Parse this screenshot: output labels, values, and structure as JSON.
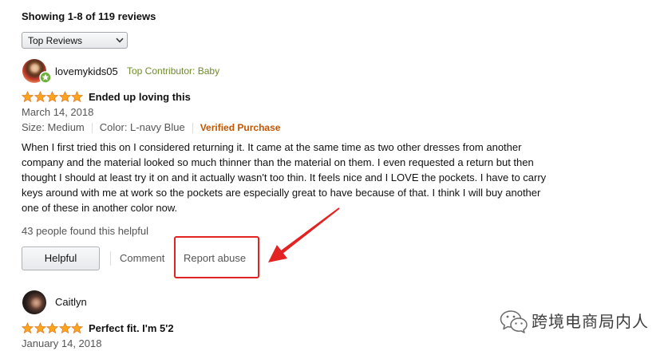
{
  "colors": {
    "text": "#111111",
    "muted": "#555555",
    "badge": "#6e8b2a",
    "badge_green": "#6fb13d",
    "verified": "#c45500",
    "star_fill": "#ffa41c",
    "star_stroke": "#de7921",
    "highlight": "#e32222",
    "watermark": "#3d3d3d"
  },
  "reviews_header": {
    "count_text": "Showing 1-8 of 119 reviews"
  },
  "sort_dropdown": {
    "selected": "Top Reviews",
    "icon": "chevron-down-icon"
  },
  "reviews": [
    {
      "author": "lovemykids05",
      "badge": "Top Contributor: Baby",
      "badge_icon": "top-contributor-badge-icon",
      "rating": 5,
      "rating_max": 5,
      "title": "Ended up loving this",
      "date": "March 14, 2018",
      "size": "Size: Medium",
      "color": "Color: L-navy Blue",
      "verified": "Verified Purchase",
      "body_lines": [
        "When I first tried this on I considered returning it. It came at the same time as two other dresses from another",
        "company and the material looked so much thinner than the material on them. I even requested a return but then",
        "thought I should at least try it on and it actually wasn't too thin. It feels nice and I LOVE the pockets. I have to carry",
        "keys around with me at work so the pockets are especially great to have because of that. I think I will buy another",
        "one of these in another color now."
      ],
      "helpful_text": "43 people found this helpful",
      "actions": {
        "helpful": "Helpful",
        "comment": "Comment",
        "report_abuse": "Report abuse"
      }
    },
    {
      "author": "Caitlyn",
      "rating": 5,
      "rating_max": 5,
      "title": "Perfect fit. I'm 5'2",
      "date": "January 14, 2018"
    }
  ],
  "watermark": {
    "icon": "wechat-icon",
    "text": "跨境电商局内人"
  }
}
